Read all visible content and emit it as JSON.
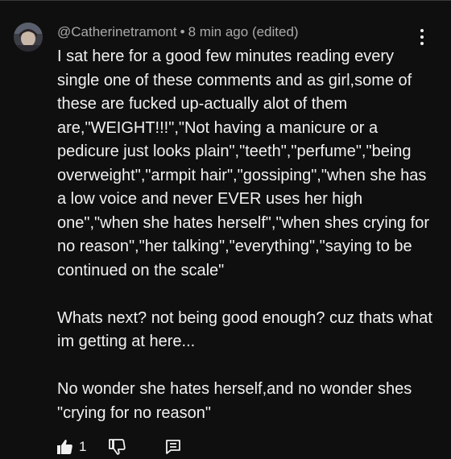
{
  "comment": {
    "author": "@Catherinetramont",
    "separator": "•",
    "time": "8 min ago (edited)",
    "paragraphs": [
      "I sat here for a good few minutes reading every single one of these comments and as girl,some of these are fucked up-actually alot of them are,\"WEIGHT!!!\",\"Not having a manicure or a pedicure just looks plain\",\"teeth\",\"perfume\",\"being overweight\",\"armpit hair\",\"gossiping\",\"when she has a low voice and never EVER uses her high one\",\"when she hates herself\",\"when shes crying for no reason\",\"her talking\",\"everything\",\"saying to be continued on the scale\"",
      "Whats next? not being good enough? cuz thats what im getting at here...",
      "No wonder she hates herself,and no wonder shes \"crying for no reason\""
    ],
    "like_count": "1"
  },
  "icons": {
    "avatar": "profile-avatar",
    "more": "more-vert-icon",
    "like": "thumb-up-icon",
    "dislike": "thumb-down-icon",
    "reply": "comment-reply-icon"
  },
  "colors": {
    "background": "#0f0f0f",
    "text": "#f1f1f1",
    "meta": "#aaaaaa"
  }
}
